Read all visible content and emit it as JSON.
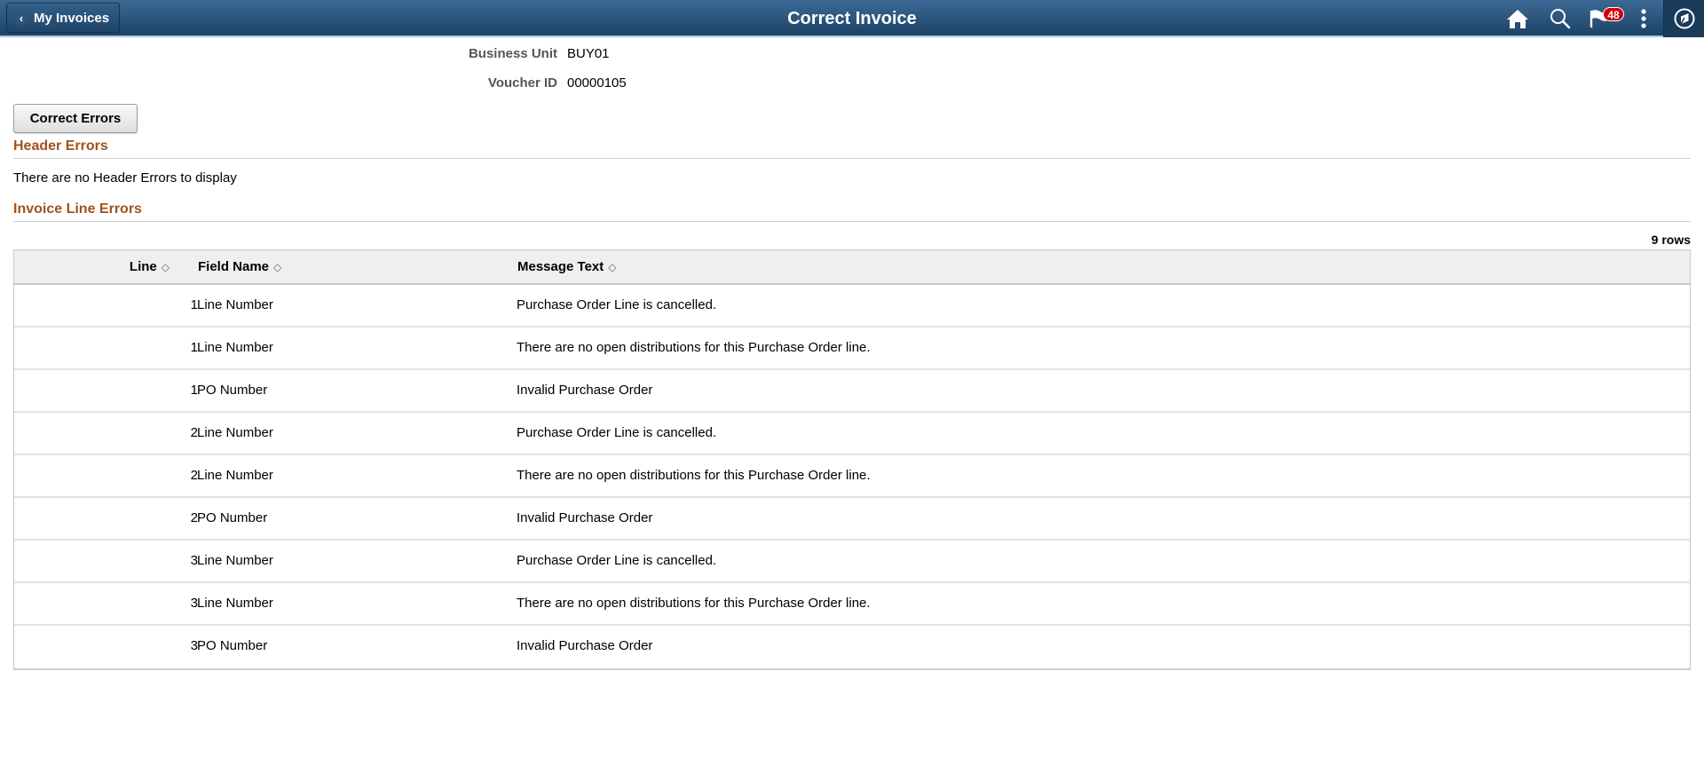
{
  "header": {
    "back_label": "My Invoices",
    "title": "Correct Invoice",
    "notification_count": "48",
    "icons": [
      "home-icon",
      "search-icon",
      "notifications-flag-icon",
      "actions-menu-icon",
      "navbar-compass-icon"
    ]
  },
  "fields": {
    "business_unit": {
      "label": "Business Unit",
      "value": "BUY01"
    },
    "voucher_id": {
      "label": "Voucher ID",
      "value": "00000105"
    }
  },
  "buttons": {
    "correct_errors": "Correct Errors"
  },
  "header_errors": {
    "title": "Header Errors",
    "empty_text": "There are no Header Errors to display"
  },
  "line_errors": {
    "title": "Invoice Line Errors",
    "row_count": "9 rows",
    "columns": {
      "line": "Line",
      "field_name": "Field Name",
      "message_text": "Message Text"
    },
    "rows": [
      {
        "line": "1",
        "field_name": "Line Number",
        "message": "Purchase Order Line is cancelled."
      },
      {
        "line": "1",
        "field_name": "Line Number",
        "message": "There are no open distributions for this Purchase Order line."
      },
      {
        "line": "1",
        "field_name": "PO Number",
        "message": "Invalid Purchase Order"
      },
      {
        "line": "2",
        "field_name": "Line Number",
        "message": "Purchase Order Line is cancelled."
      },
      {
        "line": "2",
        "field_name": "Line Number",
        "message": "There are no open distributions for this Purchase Order line."
      },
      {
        "line": "2",
        "field_name": "PO Number",
        "message": "Invalid Purchase Order"
      },
      {
        "line": "3",
        "field_name": "Line Number",
        "message": "Purchase Order Line is cancelled."
      },
      {
        "line": "3",
        "field_name": "Line Number",
        "message": "There are no open distributions for this Purchase Order line."
      },
      {
        "line": "3",
        "field_name": "PO Number",
        "message": "Invalid Purchase Order"
      }
    ]
  },
  "colors": {
    "header_bg": "#2b5479",
    "section_title": "#a0521d",
    "badge": "#d40000"
  }
}
